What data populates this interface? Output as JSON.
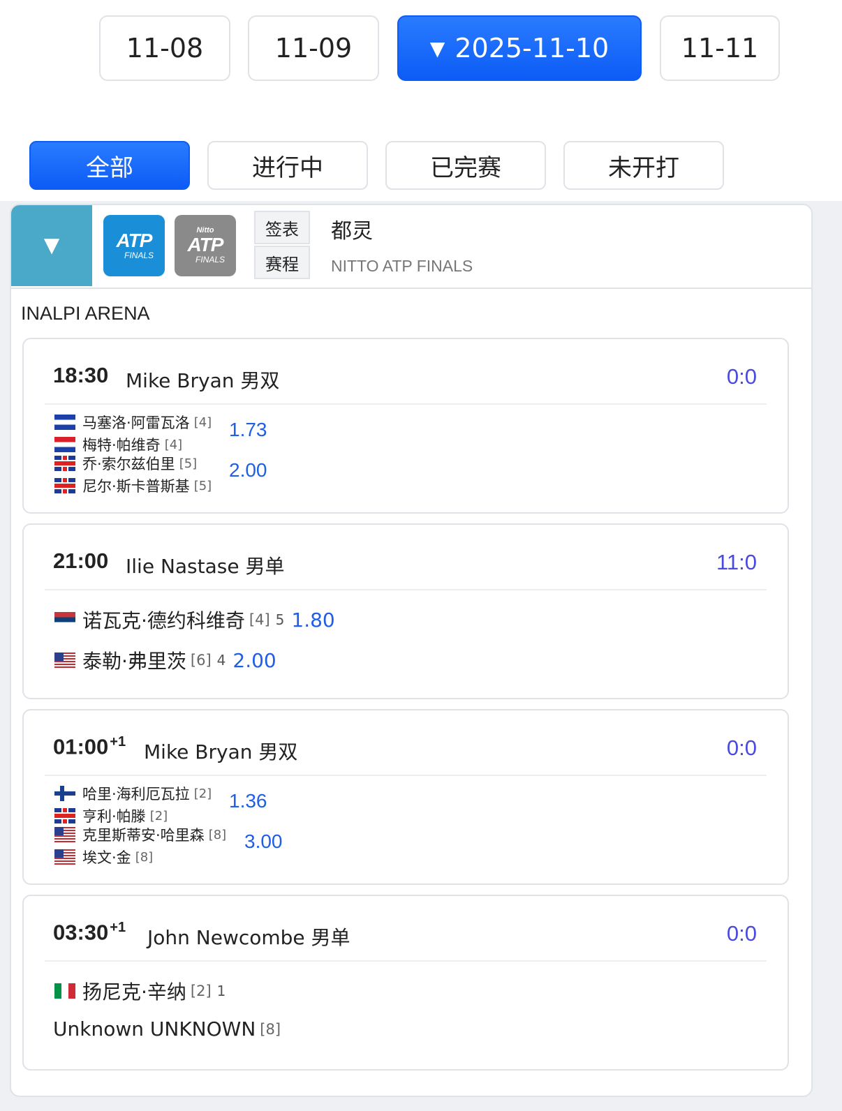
{
  "dates": [
    {
      "label": "11-08",
      "active": false
    },
    {
      "label": "11-09",
      "active": false
    },
    {
      "label": "2025-11-10",
      "active": true
    },
    {
      "label": "11-11",
      "active": false
    }
  ],
  "active_date_marker": "▼",
  "filters": [
    "全部",
    "进行中",
    "已完赛",
    "未开打"
  ],
  "tournament": {
    "collapse_icon": "▼",
    "logo1": {
      "atp": "ATP",
      "finals": "FINALS"
    },
    "logo2": {
      "nitto": "Nitto",
      "atp": "ATP",
      "finals": "FINALS"
    },
    "draw_link": "签表",
    "schedule_link": "赛程",
    "city": "都灵",
    "name": "NITTO ATP FINALS",
    "venue": "INALPI ARENA"
  },
  "matches": [
    {
      "time": "18:30",
      "day_offset": "",
      "umpire": "Mike Bryan 男双",
      "score": "0:0",
      "players": [
        {
          "name": "马塞洛·阿雷瓦洛",
          "seed": "[4]",
          "flag": "sv"
        },
        {
          "name": "梅特·帕维奇",
          "seed": "[4]",
          "flag": "hr"
        },
        {
          "name": "乔·索尔兹伯里",
          "seed": "[5]",
          "flag": "gb"
        },
        {
          "name": "尼尔·斯卡普斯基",
          "seed": "[5]",
          "flag": "gb"
        }
      ],
      "odds": [
        "1.73",
        "2.00"
      ]
    },
    {
      "time": "21:00",
      "day_offset": "",
      "umpire": "Ilie Nastase 男单",
      "score": "11:0",
      "players": [
        {
          "name": "诺瓦克·德约科维奇",
          "seed": "[4]",
          "set": "5",
          "odds": "1.80",
          "flag": "rs"
        },
        {
          "name": "泰勒·弗里茨",
          "seed": "[6]",
          "set": "4",
          "odds": "2.00",
          "flag": "us"
        }
      ]
    },
    {
      "time": "01:00",
      "day_offset": "+1",
      "umpire": "Mike Bryan 男双",
      "score": "0:0",
      "players": [
        {
          "name": "哈里·海利厄瓦拉",
          "seed": "[2]",
          "flag": "fi"
        },
        {
          "name": "亨利·帕滕",
          "seed": "[2]",
          "flag": "gb"
        },
        {
          "name": "克里斯蒂安·哈里森",
          "seed": "[8]",
          "flag": "us"
        },
        {
          "name": "埃文·金",
          "seed": "[8]",
          "flag": "us"
        }
      ],
      "odds": [
        "1.36",
        "3.00"
      ]
    },
    {
      "time": "03:30",
      "day_offset": "+1",
      "umpire": "John Newcombe 男单",
      "score": "0:0",
      "players": [
        {
          "name": "扬尼克·辛纳",
          "seed": "[2]",
          "set": "1",
          "flag": "it"
        },
        {
          "name": "Unknown UNKNOWN",
          "seed": "[8]"
        }
      ]
    }
  ]
}
